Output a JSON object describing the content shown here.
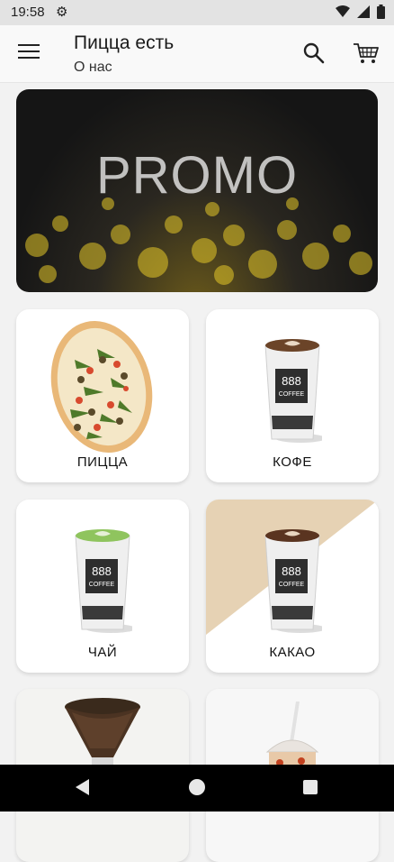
{
  "status_bar": {
    "time": "19:58"
  },
  "app_bar": {
    "title": "Пицца есть",
    "subtitle": "О нас"
  },
  "promo": {
    "text": "PROMO"
  },
  "categories": [
    {
      "label": "ПИЦЦА"
    },
    {
      "label": "КОФЕ"
    },
    {
      "label": "ЧАЙ"
    },
    {
      "label": "КАКАО"
    },
    {
      "label": ""
    },
    {
      "label": ""
    }
  ],
  "cup_brand": {
    "number": "888",
    "word": "COFFEE"
  },
  "icons": {
    "menu": "menu-icon",
    "search": "search-icon",
    "cart": "cart-icon",
    "settings": "gear-icon"
  }
}
